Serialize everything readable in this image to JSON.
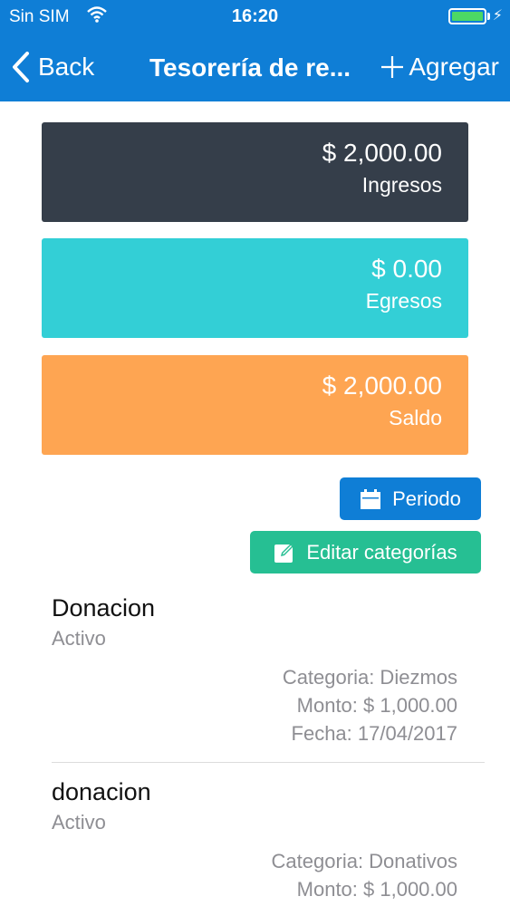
{
  "status_bar": {
    "carrier": "Sin SIM",
    "time": "16:20"
  },
  "nav": {
    "back_label": "Back",
    "title": "Tesorería de re...",
    "add_label": "Agregar"
  },
  "summary": [
    {
      "amount": "$ 2,000.00",
      "label": "Ingresos",
      "color": "#353e4a"
    },
    {
      "amount": "$ 0.00",
      "label": "Egresos",
      "color": "#33cfd6"
    },
    {
      "amount": "$ 2,000.00",
      "label": "Saldo",
      "color": "#fea552"
    }
  ],
  "actions": {
    "periodo_label": "Periodo",
    "editar_label": "Editar categorías"
  },
  "transactions": [
    {
      "title": "Donacion",
      "status": "Activo",
      "categoria": "Categoria: Diezmos",
      "monto": "Monto: $ 1,000.00",
      "fecha": "Fecha: 17/04/2017"
    },
    {
      "title": "donacion",
      "status": "Activo",
      "categoria": "Categoria: Donativos",
      "monto": "Monto: $ 1,000.00"
    }
  ]
}
